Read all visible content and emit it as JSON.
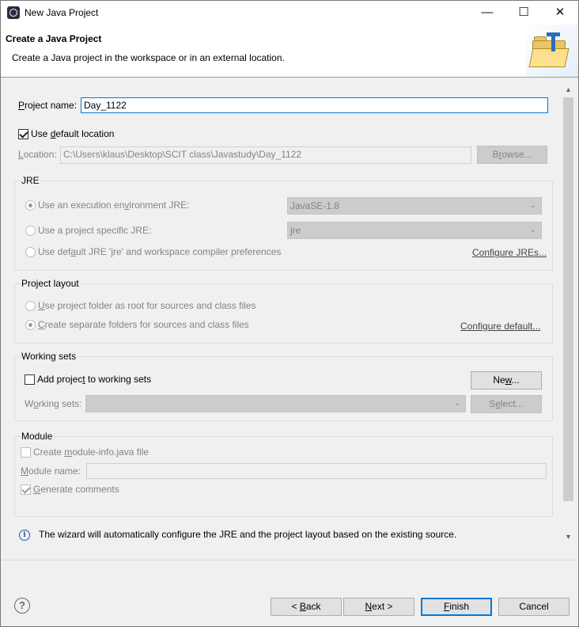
{
  "window": {
    "title": "New Java Project",
    "min_icon": "minimize-icon",
    "max_icon": "maximize-icon",
    "close_icon": "close-icon",
    "min_glyph": "—",
    "max_glyph": "☐",
    "close_glyph": "✕"
  },
  "banner": {
    "title": "Create a Java Project",
    "description": "Create a Java project in the workspace or in an external location.",
    "icon": "new-java-project-folder-icon"
  },
  "project": {
    "name_label_prefix": "",
    "name_label_u": "P",
    "name_label_rest": "roject name:",
    "name_value": "Day_1122",
    "use_default_location_pre": "Use ",
    "use_default_location_u": "d",
    "use_default_location_post": "efault location",
    "use_default_location_checked": true,
    "location_label_u": "L",
    "location_label_rest": "ocation:",
    "location_value": "C:\\Users\\klaus\\Desktop\\SCIT class\\Javastudy\\Day_1122",
    "browse_u": "r",
    "browse_pre": "B",
    "browse_post": "owse..."
  },
  "jre": {
    "title": "JRE",
    "opt_env_pre": "Use an execution en",
    "opt_env_u": "v",
    "opt_env_post": "ironment JRE:",
    "opt_env_value": "JavaSE-1.8",
    "opt_specific_pre": "Use a pro",
    "opt_specific_u": "j",
    "opt_specific_post": "ect specific JRE:",
    "opt_specific_value": "jre",
    "opt_default_pre": "Use def",
    "opt_default_u": "a",
    "opt_default_post": "ult JRE 'jre' and workspace compiler preferences",
    "configure_jres": "Configure JREs..."
  },
  "layout": {
    "title": "Project layout",
    "opt_root_pre": "",
    "opt_root_u": "U",
    "opt_root_post": "se project folder as root for sources and class files",
    "opt_separate_u": "C",
    "opt_separate_post": "reate separate folders for sources and class files",
    "configure_default": "Configure default..."
  },
  "working_sets": {
    "title": "Working sets",
    "add_pre": "Add projec",
    "add_u": "t",
    "add_post": " to working sets",
    "new_pre": "Ne",
    "new_u": "w",
    "new_post": "...",
    "sets_label_pre": "W",
    "sets_label_u": "o",
    "sets_label_post": "rking sets:",
    "select_pre": "S",
    "select_u": "e",
    "select_post": "lect..."
  },
  "module": {
    "title": "Module",
    "create_pre": "Create ",
    "create_u": "m",
    "create_post": "odule-info.java file",
    "name_label_u": "M",
    "name_label_post": "odule name:",
    "generate_u": "G",
    "generate_post": "enerate comments"
  },
  "info": {
    "icon": "info-icon",
    "glyph": "i",
    "text": "The wizard will automatically configure the JRE and the project layout based on the existing source."
  },
  "footer": {
    "help_glyph": "?",
    "back_pre": "< ",
    "back_u": "B",
    "back_post": "ack",
    "next_u": "N",
    "next_post": "ext >",
    "finish_u": "F",
    "finish_post": "inish",
    "cancel": "Cancel"
  },
  "icons": {
    "scroll_up": "▴",
    "scroll_down": "▾",
    "chevron": "⌄"
  }
}
